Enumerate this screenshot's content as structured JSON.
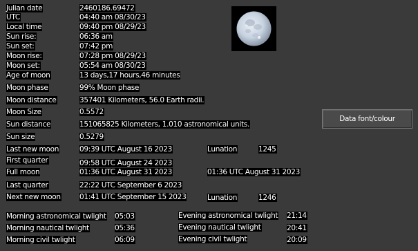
{
  "info": {
    "julian_date_label": "Julian date",
    "julian_date_value": "2460186.69472",
    "utc_label": "UTC",
    "utc_value": "04:40 am 08/30/23",
    "local_time_label": "Local time",
    "local_time_value": "09:40 pm 08/29/23",
    "sun_rise_label": "Sun rise:",
    "sun_rise_value": "06:36 am",
    "sun_set_label": "Sun set:",
    "sun_set_value": "07:42 pm",
    "moon_rise_label": "Moon rise:",
    "moon_rise_value": "07:28 pm 08/29/23",
    "moon_set_label": "Moon set:",
    "moon_set_value": "05:54 am 08/30/23",
    "age_of_moon_label": "Age of moon",
    "age_of_moon_value": "13 days,17 hours,46 minutes",
    "moon_phase_label": "Moon phase",
    "moon_phase_value": "99% Moon phase",
    "moon_distance_label": "Moon distance",
    "moon_distance_value": "357401 Kilometers, 56.0 Earth radii.",
    "moon_size_label": "Moon Size",
    "moon_size_value": "0.5572",
    "sun_distance_label": "Sun distance",
    "sun_distance_value": "151065825 Kilometers,  1.010 astronomical units.",
    "sun_size_label": "Sun size",
    "sun_size_value": "0.5279"
  },
  "phases": {
    "last_new_moon_label": "Last new moon",
    "last_new_moon_value": "09:39 UTC August 16 2023",
    "lunation_label_1": "Lunation",
    "lunation_value_1": "1245",
    "first_quarter_label": "First quarter",
    "first_quarter_value": "09:58 UTC August 24 2023",
    "full_moon_label": "Full moon",
    "full_moon_value": "01:36 UTC August 31 2023",
    "full_moon_value_2": "01:36 UTC August 31 2023",
    "last_quarter_label": "Last quarter",
    "last_quarter_value": "22:22 UTC September 6 2023",
    "next_new_moon_label": "Next new moon",
    "next_new_moon_value": "01:41 UTC September 15 2023",
    "lunation_label_2": "Lunation",
    "lunation_value_2": "1246"
  },
  "twilight": {
    "morning_astro_label": "Morning astronomical twlight",
    "morning_astro_value": "05:03",
    "morning_nautical_label": "Morning nautical twlight",
    "morning_nautical_value": "05:36",
    "morning_civil_label": "Morning civil twlight",
    "morning_civil_value": "06:09",
    "evening_astro_label": "Evening astronomical twlight",
    "evening_astro_value": "21:14",
    "evening_nautical_label": "Evening nautical twlight",
    "evening_nautical_value": "20:41",
    "evening_civil_label": "Evening civil twlight",
    "evening_civil_value": "20:09"
  },
  "buttons": {
    "data_font_colour": "Data font/colour"
  },
  "icons": {
    "moon": "full-moon-icon"
  },
  "colors": {
    "background": "#3a3a3a",
    "label_background": "#000000",
    "text": "#ffffff"
  }
}
